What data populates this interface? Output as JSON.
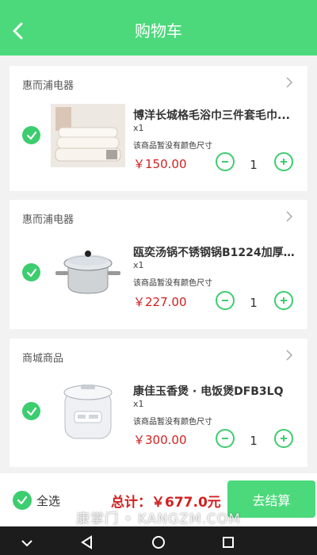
{
  "header": {
    "title": "购物车"
  },
  "items": [
    {
      "shop": "惠而浦电器",
      "name": "博洋长城格毛浴巾三件套毛巾...",
      "qty_text": "x1",
      "note": "该商品暂没有颜色尺寸",
      "price": "￥150.00",
      "count": "1",
      "thumb": "towel-set"
    },
    {
      "shop": "惠而浦电器",
      "name": "瓯奕汤锅不锈钢锅B1224加厚...",
      "qty_text": "x1",
      "note": "该商品暂没有颜色尺寸",
      "price": "￥227.00",
      "count": "1",
      "thumb": "stainless-pot"
    },
    {
      "shop": "商城商品",
      "name": "康佳玉香煲 · 电饭煲DFB3LQ",
      "qty_text": "x1",
      "note": "该商品暂没有颜色尺寸",
      "price": "￥300.00",
      "count": "1",
      "thumb": "rice-cooker"
    }
  ],
  "footer": {
    "select_all": "全选",
    "total": "总计：￥677.0元",
    "checkout": "去结算"
  },
  "watermark": "康掌门 • KANGZM.COM",
  "colors": {
    "accent": "#4cd97b",
    "price": "#d12020"
  }
}
